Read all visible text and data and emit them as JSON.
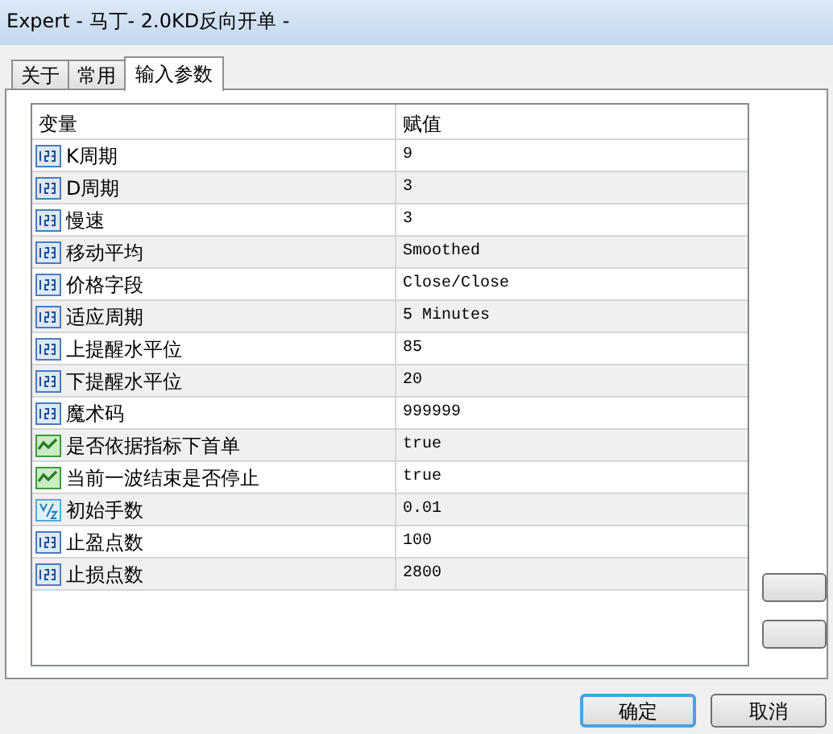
{
  "window": {
    "title": "Expert - 马丁- 2.0KD反向开单 -"
  },
  "tabs": [
    {
      "label": "关于",
      "selected": false
    },
    {
      "label": "常用",
      "selected": false
    },
    {
      "label": "输入参数",
      "selected": true
    }
  ],
  "table": {
    "columns": [
      "变量",
      "赋值"
    ],
    "rows": [
      {
        "kind": "int",
        "name": "K周期",
        "value": "9"
      },
      {
        "kind": "int",
        "name": "D周期",
        "value": "3"
      },
      {
        "kind": "int",
        "name": "慢速",
        "value": "3"
      },
      {
        "kind": "int",
        "name": "移动平均",
        "value": "Smoothed"
      },
      {
        "kind": "int",
        "name": "价格字段",
        "value": "Close/Close"
      },
      {
        "kind": "int",
        "name": "适应周期",
        "value": "5 Minutes"
      },
      {
        "kind": "int",
        "name": "上提醒水平位",
        "value": "85"
      },
      {
        "kind": "int",
        "name": "下提醒水平位",
        "value": "20"
      },
      {
        "kind": "int",
        "name": "魔术码",
        "value": "999999"
      },
      {
        "kind": "bool",
        "name": "是否依据指标下首单",
        "value": "true"
      },
      {
        "kind": "bool",
        "name": "当前一波结束是否停止",
        "value": "true"
      },
      {
        "kind": "double",
        "name": "初始手数",
        "value": "0.01"
      },
      {
        "kind": "int",
        "name": "止盈点数",
        "value": "100"
      },
      {
        "kind": "int",
        "name": "止损点数",
        "value": "2800"
      }
    ]
  },
  "buttons": [
    {
      "label": "确定",
      "default": true
    },
    {
      "label": "取消",
      "default": false
    }
  ]
}
